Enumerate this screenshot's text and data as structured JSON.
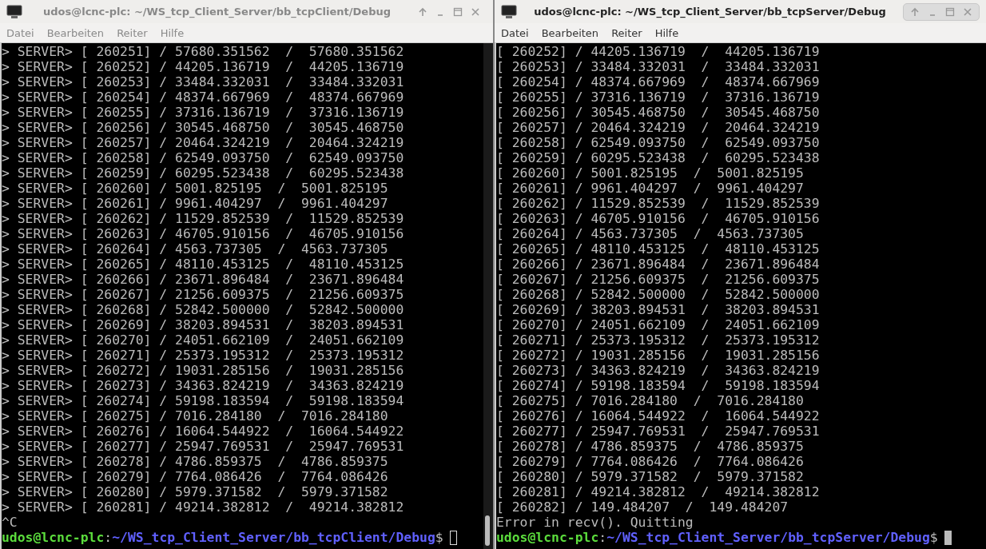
{
  "windows": [
    {
      "title": "udos@lcnc-plc: ~/WS_tcp_Client_Server/bb_tcpClient/Debug",
      "active": false,
      "scrollbar": true,
      "menu": [
        "Datei",
        "Bearbeiten",
        "Reiter",
        "Hilfe"
      ],
      "lines": [
        "> SERVER> [ 260251] / 57680.351562  /  57680.351562",
        "> SERVER> [ 260252] / 44205.136719  /  44205.136719",
        "> SERVER> [ 260253] / 33484.332031  /  33484.332031",
        "> SERVER> [ 260254] / 48374.667969  /  48374.667969",
        "> SERVER> [ 260255] / 37316.136719  /  37316.136719",
        "> SERVER> [ 260256] / 30545.468750  /  30545.468750",
        "> SERVER> [ 260257] / 20464.324219  /  20464.324219",
        "> SERVER> [ 260258] / 62549.093750  /  62549.093750",
        "> SERVER> [ 260259] / 60295.523438  /  60295.523438",
        "> SERVER> [ 260260] / 5001.825195  /  5001.825195",
        "> SERVER> [ 260261] / 9961.404297  /  9961.404297",
        "> SERVER> [ 260262] / 11529.852539  /  11529.852539",
        "> SERVER> [ 260263] / 46705.910156  /  46705.910156",
        "> SERVER> [ 260264] / 4563.737305  /  4563.737305",
        "> SERVER> [ 260265] / 48110.453125  /  48110.453125",
        "> SERVER> [ 260266] / 23671.896484  /  23671.896484",
        "> SERVER> [ 260267] / 21256.609375  /  21256.609375",
        "> SERVER> [ 260268] / 52842.500000  /  52842.500000",
        "> SERVER> [ 260269] / 38203.894531  /  38203.894531",
        "> SERVER> [ 260270] / 24051.662109  /  24051.662109",
        "> SERVER> [ 260271] / 25373.195312  /  25373.195312",
        "> SERVER> [ 260272] / 19031.285156  /  19031.285156",
        "> SERVER> [ 260273] / 34363.824219  /  34363.824219",
        "> SERVER> [ 260274] / 59198.183594  /  59198.183594",
        "> SERVER> [ 260275] / 7016.284180  /  7016.284180",
        "> SERVER> [ 260276] / 16064.544922  /  16064.544922",
        "> SERVER> [ 260277] / 25947.769531  /  25947.769531",
        "> SERVER> [ 260278] / 4786.859375  /  4786.859375",
        "> SERVER> [ 260279] / 7764.086426  /  7764.086426",
        "> SERVER> [ 260280] / 5979.371582  /  5979.371582",
        "> SERVER> [ 260281] / 49214.382812  /  49214.382812",
        "^C"
      ],
      "prompt": {
        "user_host": "udos@lcnc-plc",
        "separator": ":",
        "path": "~/WS_tcp_Client_Server/bb_tcpClient/Debug",
        "symbol": "$"
      }
    },
    {
      "title": "udos@lcnc-plc: ~/WS_tcp_Client_Server/bb_tcpServer/Debug",
      "active": true,
      "scrollbar": false,
      "menu": [
        "Datei",
        "Bearbeiten",
        "Reiter",
        "Hilfe"
      ],
      "lines": [
        "[ 260252] / 44205.136719  /  44205.136719",
        "[ 260253] / 33484.332031  /  33484.332031",
        "[ 260254] / 48374.667969  /  48374.667969",
        "[ 260255] / 37316.136719  /  37316.136719",
        "[ 260256] / 30545.468750  /  30545.468750",
        "[ 260257] / 20464.324219  /  20464.324219",
        "[ 260258] / 62549.093750  /  62549.093750",
        "[ 260259] / 60295.523438  /  60295.523438",
        "[ 260260] / 5001.825195  /  5001.825195",
        "[ 260261] / 9961.404297  /  9961.404297",
        "[ 260262] / 11529.852539  /  11529.852539",
        "[ 260263] / 46705.910156  /  46705.910156",
        "[ 260264] / 4563.737305  /  4563.737305",
        "[ 260265] / 48110.453125  /  48110.453125",
        "[ 260266] / 23671.896484  /  23671.896484",
        "[ 260267] / 21256.609375  /  21256.609375",
        "[ 260268] / 52842.500000  /  52842.500000",
        "[ 260269] / 38203.894531  /  38203.894531",
        "[ 260270] / 24051.662109  /  24051.662109",
        "[ 260271] / 25373.195312  /  25373.195312",
        "[ 260272] / 19031.285156  /  19031.285156",
        "[ 260273] / 34363.824219  /  34363.824219",
        "[ 260274] / 59198.183594  /  59198.183594",
        "[ 260275] / 7016.284180  /  7016.284180",
        "[ 260276] / 16064.544922  /  16064.544922",
        "[ 260277] / 25947.769531  /  25947.769531",
        "[ 260278] / 4786.859375  /  4786.859375",
        "[ 260279] / 7764.086426  /  7764.086426",
        "[ 260280] / 5979.371582  /  5979.371582",
        "[ 260281] / 49214.382812  /  49214.382812",
        "[ 260282] / 149.484207  /  149.484207",
        "Error in recv(). Quitting"
      ],
      "prompt": {
        "user_host": "udos@lcnc-plc",
        "separator": ":",
        "path": "~/WS_tcp_Client_Server/bb_tcpServer/Debug",
        "symbol": "$"
      }
    }
  ]
}
